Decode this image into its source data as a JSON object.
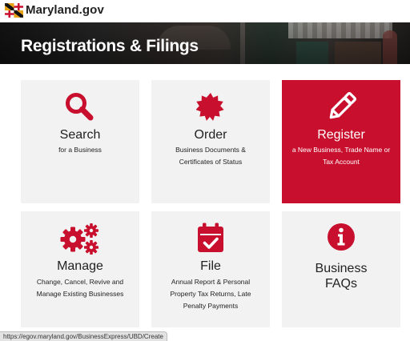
{
  "header": {
    "brand": "Maryland.gov",
    "flag_icon": "maryland-flag-icon"
  },
  "hero": {
    "title": "Registrations & Filings"
  },
  "cards": [
    {
      "icon": "search-icon",
      "title": "Search",
      "sub": "for a Business"
    },
    {
      "icon": "seal-icon",
      "title": "Order",
      "sub": "Business Documents & Certificates of Status"
    },
    {
      "icon": "pencil-icon",
      "title": "Register",
      "sub": "a New Business, Trade Name or Tax Account",
      "active": true
    },
    {
      "icon": "gears-icon",
      "title": "Manage",
      "sub": "Change, Cancel, Revive and Manage Existing Businesses"
    },
    {
      "icon": "calendar-check-icon",
      "title": "File",
      "sub": "Annual Report & Personal Property Tax Returns, Late Penalty Payments"
    },
    {
      "icon": "info-icon",
      "title": "Business FAQs",
      "sub": ""
    }
  ],
  "status": {
    "url": "https://egov.maryland.gov/BusinessExpress/UBD/Create"
  },
  "colors": {
    "accent": "#c8102e",
    "card_bg": "#f2f2f2",
    "text": "#222222"
  }
}
